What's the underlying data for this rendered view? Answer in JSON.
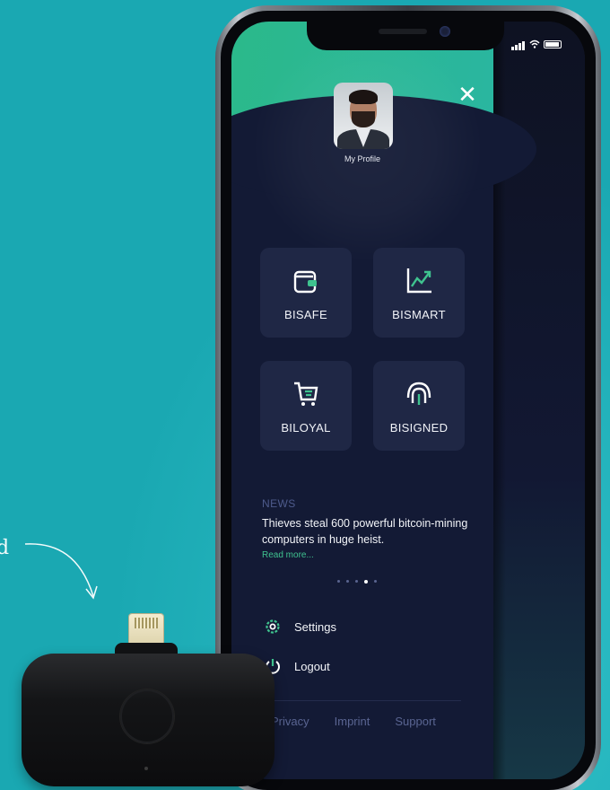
{
  "background_text": "d",
  "status": {
    "signal": "signal-icon",
    "wifi": "wifi-icon",
    "battery": "battery-icon"
  },
  "profile": {
    "label": "My Profile",
    "close_icon": "close-icon"
  },
  "tiles": [
    {
      "label": "BISAFE",
      "icon": "wallet-icon"
    },
    {
      "label": "BISMART",
      "icon": "chart-trend-icon"
    },
    {
      "label": "BILOYAL",
      "icon": "cart-icon"
    },
    {
      "label": "BISIGNED",
      "icon": "fingerprint-icon"
    }
  ],
  "news": {
    "heading": "NEWS",
    "text": "Thieves steal 600 powerful bitcoin-mining computers in huge heist.",
    "more": "Read more...",
    "page_count": 5,
    "active_page": 4
  },
  "menu": [
    {
      "label": "Settings",
      "icon": "gear-icon"
    },
    {
      "label": "Logout",
      "icon": "power-icon"
    }
  ],
  "footer": [
    "Privacy",
    "Imprint",
    "Support"
  ],
  "colors": {
    "accent": "#3fc38f",
    "background": "#1aa8b2",
    "drawer": "#131a35",
    "tile": "#1f2745"
  }
}
